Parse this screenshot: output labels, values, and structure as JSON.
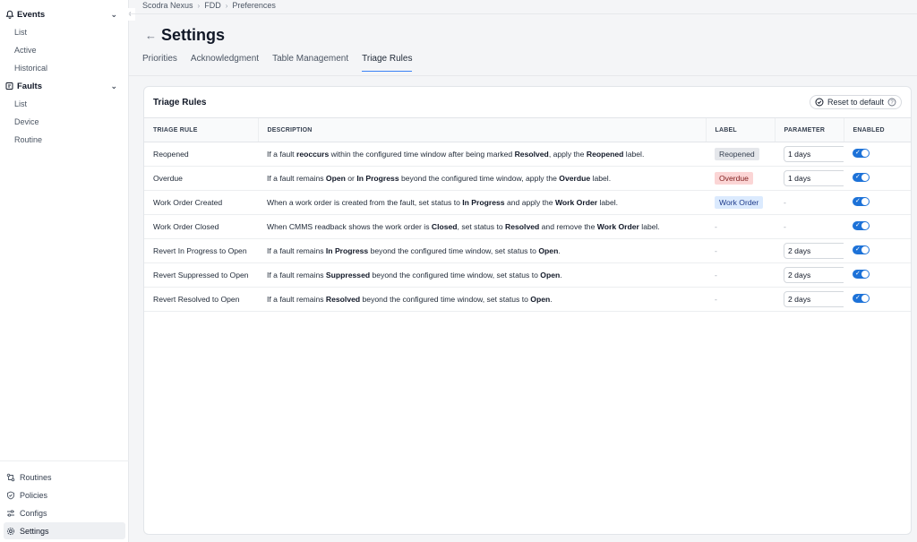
{
  "sidebar": {
    "groups": [
      {
        "label": "Events",
        "icon": "bell-icon",
        "items": [
          "List",
          "Active",
          "Historical"
        ]
      },
      {
        "label": "Faults",
        "icon": "fault-icon",
        "items": [
          "List",
          "Device",
          "Routine"
        ]
      }
    ],
    "bottom": [
      {
        "label": "Routines",
        "icon": "routines-icon"
      },
      {
        "label": "Policies",
        "icon": "shield-icon"
      },
      {
        "label": "Configs",
        "icon": "sliders-icon"
      },
      {
        "label": "Settings",
        "icon": "gear-icon",
        "active": true
      }
    ]
  },
  "breadcrumb": [
    "Scodra Nexus",
    "FDD",
    "Preferences"
  ],
  "page": {
    "title": "Settings",
    "tabs": [
      {
        "label": "Priorities",
        "active": false
      },
      {
        "label": "Acknowledgment",
        "active": false
      },
      {
        "label": "Table Management",
        "active": false
      },
      {
        "label": "Triage Rules",
        "active": true
      }
    ]
  },
  "card": {
    "title": "Triage Rules",
    "reset_label": "Reset to default"
  },
  "table": {
    "headers": [
      "TRIAGE RULE",
      "DESCRIPTION",
      "LABEL",
      "PARAMETER",
      "ENABLED"
    ],
    "rows": [
      {
        "rule": "Reopened",
        "desc": [
          [
            "If a fault ",
            false
          ],
          [
            "reoccurs",
            true
          ],
          [
            " within the configured time window after being marked ",
            false
          ],
          [
            "Resolved",
            true
          ],
          [
            ", apply the ",
            false
          ],
          [
            "Reopened",
            true
          ],
          [
            " label.",
            false
          ]
        ],
        "label": "Reopened",
        "label_style": "grey",
        "parameter": "1 days",
        "enabled": true
      },
      {
        "rule": "Overdue",
        "desc": [
          [
            "If a fault remains ",
            false
          ],
          [
            "Open",
            true
          ],
          [
            " or ",
            false
          ],
          [
            "In Progress",
            true
          ],
          [
            " beyond the configured time window, apply the ",
            false
          ],
          [
            "Overdue",
            true
          ],
          [
            " label.",
            false
          ]
        ],
        "label": "Overdue",
        "label_style": "red",
        "parameter": "1 days",
        "enabled": true
      },
      {
        "rule": "Work Order Created",
        "desc": [
          [
            "When a work order is created from the fault, set status to ",
            false
          ],
          [
            "In Progress",
            true
          ],
          [
            " and apply the ",
            false
          ],
          [
            "Work Order",
            true
          ],
          [
            " label.",
            false
          ]
        ],
        "label": "Work Order",
        "label_style": "blue",
        "parameter": "-",
        "enabled": true
      },
      {
        "rule": "Work Order Closed",
        "desc": [
          [
            "When CMMS readback shows the work order is ",
            false
          ],
          [
            "Closed",
            true
          ],
          [
            ", set status to ",
            false
          ],
          [
            "Resolved",
            true
          ],
          [
            " and remove the ",
            false
          ],
          [
            "Work Order",
            true
          ],
          [
            " label.",
            false
          ]
        ],
        "label": "-",
        "label_style": "none",
        "parameter": "-",
        "enabled": true
      },
      {
        "rule": "Revert In Progress to Open",
        "desc": [
          [
            "If a fault remains ",
            false
          ],
          [
            "In Progress",
            true
          ],
          [
            " beyond the configured time window, set status to ",
            false
          ],
          [
            "Open",
            true
          ],
          [
            ".",
            false
          ]
        ],
        "label": "-",
        "label_style": "none",
        "parameter": "2 days",
        "enabled": true
      },
      {
        "rule": "Revert Suppressed to Open",
        "desc": [
          [
            "If a fault remains ",
            false
          ],
          [
            "Suppressed",
            true
          ],
          [
            " beyond the configured time window, set status to ",
            false
          ],
          [
            "Open",
            true
          ],
          [
            ".",
            false
          ]
        ],
        "label": "-",
        "label_style": "none",
        "parameter": "2 days",
        "enabled": true
      },
      {
        "rule": "Revert Resolved to Open",
        "desc": [
          [
            "If a fault remains ",
            false
          ],
          [
            "Resolved",
            true
          ],
          [
            " beyond the configured time window, set status to ",
            false
          ],
          [
            "Open",
            true
          ],
          [
            ".",
            false
          ]
        ],
        "label": "-",
        "label_style": "none",
        "parameter": "2 days",
        "enabled": true
      }
    ]
  }
}
